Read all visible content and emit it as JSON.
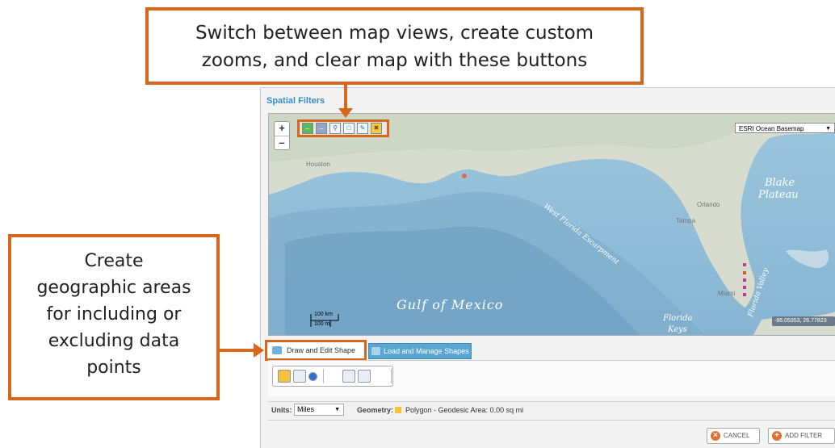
{
  "callouts": {
    "top_line1": "Switch between map views, create custom",
    "top_line2": "zooms, and clear map with these buttons",
    "left_line1": "Create",
    "left_line2": "geographic areas",
    "left_line3": "for including or",
    "left_line4": "excluding data",
    "left_line5": "points"
  },
  "panel": {
    "title": "Spatial Filters"
  },
  "map": {
    "zoom_in": "+",
    "zoom_out": "–",
    "basemap_selected": "ESRI Ocean Basemap",
    "labels": {
      "gulf": "Gulf of Mexico",
      "blake_plateau_1": "Blake",
      "blake_plateau_2": "Plateau",
      "west_florida": "West Florida Escarpment",
      "florida_keys_1": "Florida",
      "florida_keys_2": "Keys",
      "florida_valley": "Florida Valley",
      "houston": "Houston",
      "orlando": "Orlando",
      "tampa": "Tampa",
      "miami": "Miami"
    },
    "scale_km": "100 km",
    "scale_mi": "100 mi",
    "coordinates": "-86.05353, 26.77823",
    "toolbar_icons": [
      "back-arrow-icon",
      "forward-arrow-icon",
      "zoom-in-icon",
      "zoom-box-icon",
      "save-view-icon",
      "clear-map-icon"
    ]
  },
  "tabs": {
    "draw_edit": "Draw and Edit Shape",
    "load_manage": "Load and Manage Shapes"
  },
  "units": {
    "label": "Units:",
    "value": "Miles",
    "geometry_label": "Geometry:",
    "geometry_value": "Polygon - Geodesic Area: 0.00 sq mi"
  },
  "buttons": {
    "cancel": "CANCEL",
    "add_filter": "ADD FILTER"
  },
  "colors": {
    "accent": "#d9671b",
    "title_blue": "#3b8bc4",
    "ocean": "#8ebbd6"
  }
}
